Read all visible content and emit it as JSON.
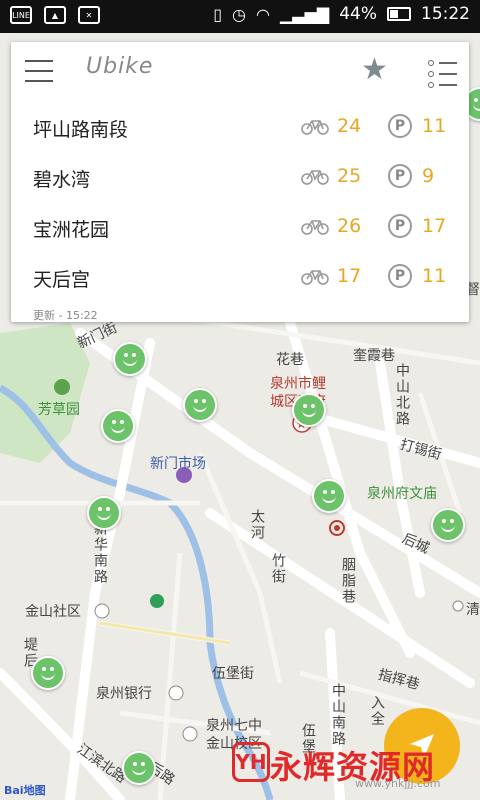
{
  "statusbar": {
    "left_icons": [
      "line-app-icon",
      "image-icon",
      "mail-icon"
    ],
    "line_label": "LINE",
    "battery": "44%",
    "time": "15:22"
  },
  "card": {
    "logo": "Ubike",
    "stations": [
      {
        "name": "坪山路南段",
        "bikes": "24",
        "parking": "11"
      },
      {
        "name": "碧水湾",
        "bikes": "25",
        "parking": "9"
      },
      {
        "name": "宝洲花园",
        "bikes": "26",
        "parking": "17"
      },
      {
        "name": "天后宫",
        "bikes": "17",
        "parking": "11"
      }
    ],
    "parking_symbol": "P",
    "updated": "更新 - 15:22"
  },
  "map": {
    "labels": {
      "xinmenjie": "新门街",
      "fangcaoyuan": "芳草园",
      "xinmen_market": "新门市场",
      "quanzhou_city": "泉州市鲤",
      "city_gov": "城区政府",
      "huaxiang": "花巷",
      "kuixiaxiang": "奎霞巷",
      "zhongshanlu": "中山北路",
      "daxijie": "打锡街",
      "wenmiao": "泉州府文庙",
      "taihe": "太河",
      "zhujie": "竹街",
      "houcheng": "后城",
      "xinhuananlu": "新华南路",
      "jinshan": "金山社区",
      "tihou": "堤后",
      "bank": "泉州银行",
      "wubaojie": "伍堡街",
      "zhihuixiang": "指挥巷",
      "qizhong": "泉州七中",
      "jinshan_campus": "金山校区",
      "jiangbin": "江滨北路",
      "zhongshannanlu": "中山南路",
      "dahou": "后路",
      "wudu": "伍堡",
      "yanxiang": "胭脂巷",
      "qing": "清",
      "ti": "堤",
      "dataxiang": "入全",
      "bangzhu": "督"
    },
    "baidu": "Bai地图"
  },
  "watermark": {
    "logo": "YH",
    "text": "永辉资源网",
    "url": "www.yhkjjj.com"
  }
}
